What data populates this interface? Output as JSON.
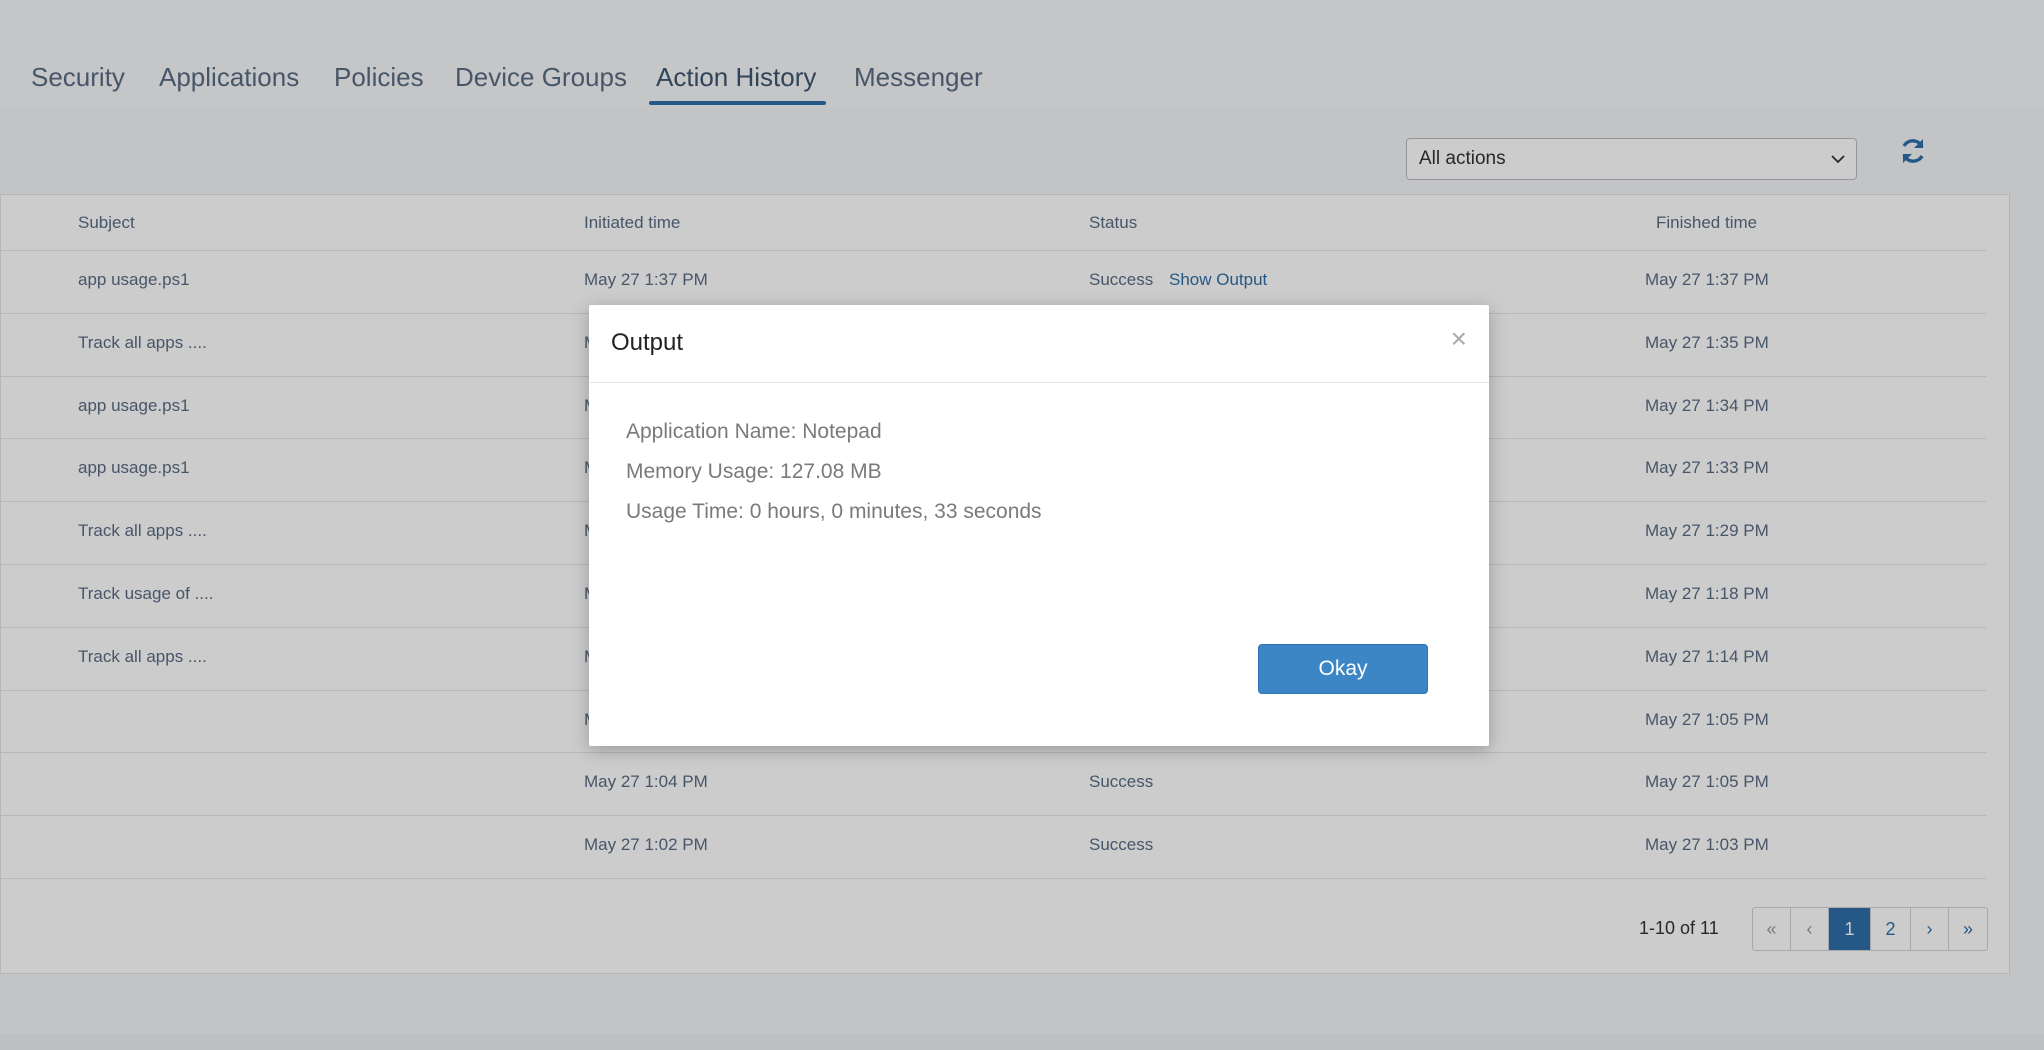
{
  "tabs": [
    {
      "label": "Security",
      "active": false
    },
    {
      "label": "Applications",
      "active": false
    },
    {
      "label": "Policies",
      "active": false
    },
    {
      "label": "Device Groups",
      "active": false
    },
    {
      "label": "Action History",
      "active": true
    },
    {
      "label": "Messenger",
      "active": false
    }
  ],
  "filter": {
    "selected": "All actions"
  },
  "refresh_icon": "refresh-icon",
  "table": {
    "headers": [
      "Subject",
      "Initiated time",
      "Status",
      "Finished time"
    ],
    "rows": [
      {
        "subject": "app usage.ps1",
        "initiated": "May 27 1:37 PM",
        "status": "Success",
        "status_link": "Show Output",
        "finished": "May 27 1:37 PM"
      },
      {
        "subject": "Track all apps ....",
        "initiated": "M",
        "status": "",
        "status_link": "",
        "finished": "May 27 1:35 PM"
      },
      {
        "subject": "app usage.ps1",
        "initiated": "M",
        "status": "",
        "status_link": "",
        "finished": "May 27 1:34 PM"
      },
      {
        "subject": "app usage.ps1",
        "initiated": "M",
        "status": "",
        "status_link": "",
        "finished": "May 27 1:33 PM"
      },
      {
        "subject": "Track all apps ....",
        "initiated": "M",
        "status": "",
        "status_link": "",
        "finished": "May 27 1:29 PM"
      },
      {
        "subject": "Track usage of ....",
        "initiated": "M",
        "status": "",
        "status_link": "",
        "finished": "May 27 1:18 PM"
      },
      {
        "subject": "Track all apps ....",
        "initiated": "M",
        "status": "",
        "status_link": "",
        "finished": "May 27 1:14 PM"
      },
      {
        "subject": "",
        "initiated": "M",
        "status": "",
        "status_link": "",
        "finished": "May 27 1:05 PM"
      },
      {
        "subject": "",
        "initiated": "May 27 1:04 PM",
        "status": "Success",
        "status_link": "",
        "finished": "May 27 1:05 PM"
      },
      {
        "subject": "",
        "initiated": "May 27 1:02 PM",
        "status": "Success",
        "status_link": "",
        "finished": "May 27 1:03 PM"
      }
    ]
  },
  "pagination": {
    "count": "1-10 of 11",
    "first": "«",
    "prev": "‹",
    "pages": [
      "1",
      "2"
    ],
    "current": "1",
    "next": "›",
    "last": "»"
  },
  "modal": {
    "title": "Output",
    "close": "×",
    "lines": [
      "Application Name: Notepad",
      "Memory Usage: 127.08 MB",
      "Usage Time: 0 hours, 0 minutes, 33 seconds"
    ],
    "ok_label": "Okay"
  },
  "colors": {
    "accent": "#2f6fa8",
    "ok_button": "#3d86c6"
  }
}
